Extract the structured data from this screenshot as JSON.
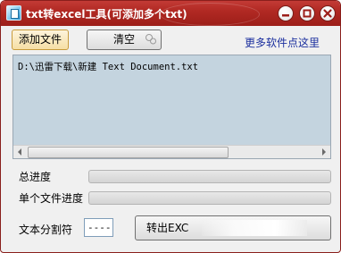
{
  "window": {
    "title": "txt转excel工具(可添加多个txt)",
    "accent_color": "#b12923"
  },
  "toolbar": {
    "add_file_label": "添加文件",
    "clear_label": "清空",
    "more_software_link": "更多软件点这里"
  },
  "file_list": {
    "items": [
      "D:\\迅雷下载\\新建 Text Document.txt"
    ]
  },
  "progress": {
    "total_label": "总进度",
    "total_value": 0,
    "single_label": "单个文件进度",
    "single_value": 0
  },
  "delimiter": {
    "label": "文本分割符",
    "value": "----"
  },
  "export": {
    "button_label": "转出EXC"
  }
}
